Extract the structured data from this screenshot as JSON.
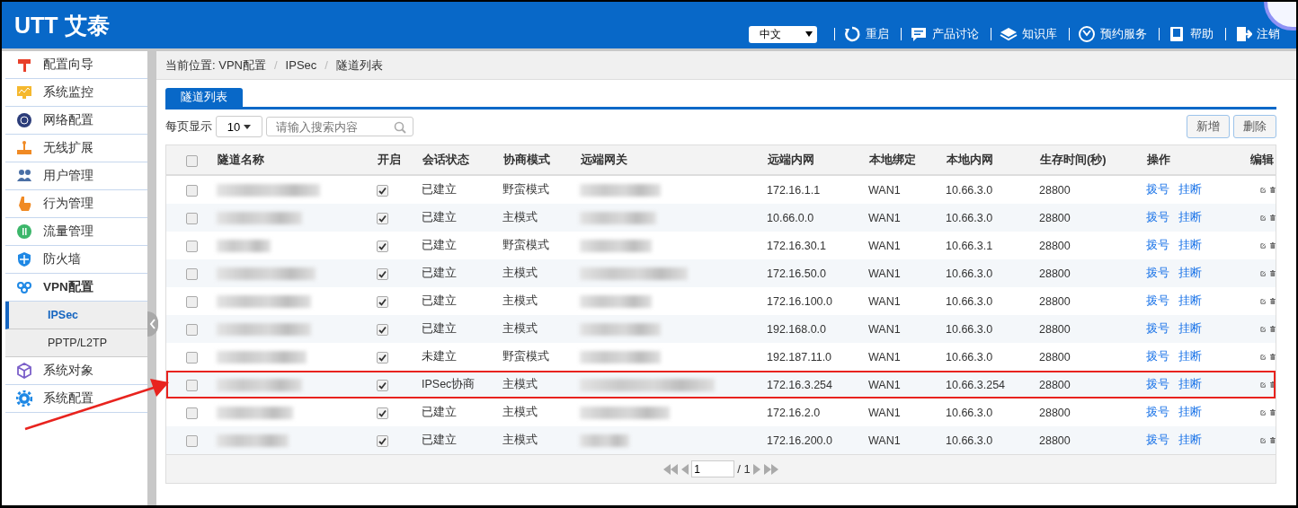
{
  "header": {
    "logo": "UTT 艾泰",
    "language": "中文",
    "links": [
      "重启",
      "产品讨论",
      "知识库",
      "预约服务",
      "帮助",
      "注销"
    ]
  },
  "sidebar": {
    "items": [
      {
        "label": "配置向导",
        "selected": false
      },
      {
        "label": "系统监控",
        "selected": false
      },
      {
        "label": "网络配置",
        "selected": false
      },
      {
        "label": "无线扩展",
        "selected": false
      },
      {
        "label": "用户管理",
        "selected": false
      },
      {
        "label": "行为管理",
        "selected": false
      },
      {
        "label": "流量管理",
        "selected": false
      },
      {
        "label": "防火墙",
        "selected": false
      },
      {
        "label": "VPN配置",
        "selected": false,
        "expanded": true,
        "children": [
          {
            "label": "IPSec",
            "selected": true
          },
          {
            "label": "PPTP/L2TP",
            "selected": false
          }
        ]
      },
      {
        "label": "系统对象",
        "selected": false
      },
      {
        "label": "系统配置",
        "selected": false
      }
    ]
  },
  "breadcrumb": {
    "separator": "/",
    "items": [
      "当前位置: VPN配置",
      "IPSec",
      "隧道列表"
    ]
  },
  "tabs": [
    {
      "label": "隧道列表",
      "selected": true
    }
  ],
  "toolbar": {
    "page_size_label": "每页显示",
    "page_size": "10",
    "search_placeholder": "请输入搜索内容",
    "buttons": [
      "新增",
      "删除"
    ]
  },
  "table": {
    "select_all_checked": false,
    "columns": [
      "隧道名称",
      "开启",
      "会话状态",
      "协商模式",
      "远端网关",
      "远端内网",
      "本地绑定",
      "本地内网",
      "生存时间(秒)",
      "操作",
      "编辑"
    ],
    "rows": [
      {
        "checked": false,
        "enabled": true,
        "status": "已建立",
        "mode": "野蛮模式",
        "remote_lan": "172.16.1.1",
        "binding": "WAN1",
        "local_lan": "10.66.3.0",
        "lifetime": "28800",
        "actions": [
          "拨号",
          "挂断"
        ],
        "highlighted": false
      },
      {
        "checked": false,
        "enabled": true,
        "status": "已建立",
        "mode": "主模式",
        "remote_lan": "10.66.0.0",
        "binding": "WAN1",
        "local_lan": "10.66.3.0",
        "lifetime": "28800",
        "actions": [
          "拨号",
          "挂断"
        ],
        "highlighted": false
      },
      {
        "checked": false,
        "enabled": true,
        "status": "已建立",
        "mode": "野蛮模式",
        "remote_lan": "172.16.30.1",
        "binding": "WAN1",
        "local_lan": "10.66.3.1",
        "lifetime": "28800",
        "actions": [
          "拨号",
          "挂断"
        ],
        "highlighted": false
      },
      {
        "checked": false,
        "enabled": true,
        "status": "已建立",
        "mode": "主模式",
        "remote_lan": "172.16.50.0",
        "binding": "WAN1",
        "local_lan": "10.66.3.0",
        "lifetime": "28800",
        "actions": [
          "拨号",
          "挂断"
        ],
        "highlighted": false
      },
      {
        "checked": false,
        "enabled": true,
        "status": "已建立",
        "mode": "主模式",
        "remote_lan": "172.16.100.0",
        "binding": "WAN1",
        "local_lan": "10.66.3.0",
        "lifetime": "28800",
        "actions": [
          "拨号",
          "挂断"
        ],
        "highlighted": false
      },
      {
        "checked": false,
        "enabled": true,
        "status": "已建立",
        "mode": "主模式",
        "remote_lan": "192.168.0.0",
        "binding": "WAN1",
        "local_lan": "10.66.3.0",
        "lifetime": "28800",
        "actions": [
          "拨号",
          "挂断"
        ],
        "highlighted": false
      },
      {
        "checked": false,
        "enabled": true,
        "status": "未建立",
        "mode": "野蛮模式",
        "remote_lan": "192.187.11.0",
        "binding": "WAN1",
        "local_lan": "10.66.3.0",
        "lifetime": "28800",
        "actions": [
          "拨号",
          "挂断"
        ],
        "highlighted": false
      },
      {
        "checked": false,
        "enabled": true,
        "status": "IPSec协商",
        "mode": "主模式",
        "remote_lan": "172.16.3.254",
        "binding": "WAN1",
        "local_lan": "10.66.3.254",
        "lifetime": "28800",
        "actions": [
          "拨号",
          "挂断"
        ],
        "highlighted": true
      },
      {
        "checked": false,
        "enabled": true,
        "status": "已建立",
        "mode": "主模式",
        "remote_lan": "172.16.2.0",
        "binding": "WAN1",
        "local_lan": "10.66.3.0",
        "lifetime": "28800",
        "actions": [
          "拨号",
          "挂断"
        ],
        "highlighted": false
      },
      {
        "checked": false,
        "enabled": true,
        "status": "已建立",
        "mode": "主模式",
        "remote_lan": "172.16.200.0",
        "binding": "WAN1",
        "local_lan": "10.66.3.0",
        "lifetime": "28800",
        "actions": [
          "拨号",
          "挂断"
        ],
        "highlighted": false
      }
    ]
  },
  "pagination": {
    "page": "1",
    "total": "/ 1"
  }
}
